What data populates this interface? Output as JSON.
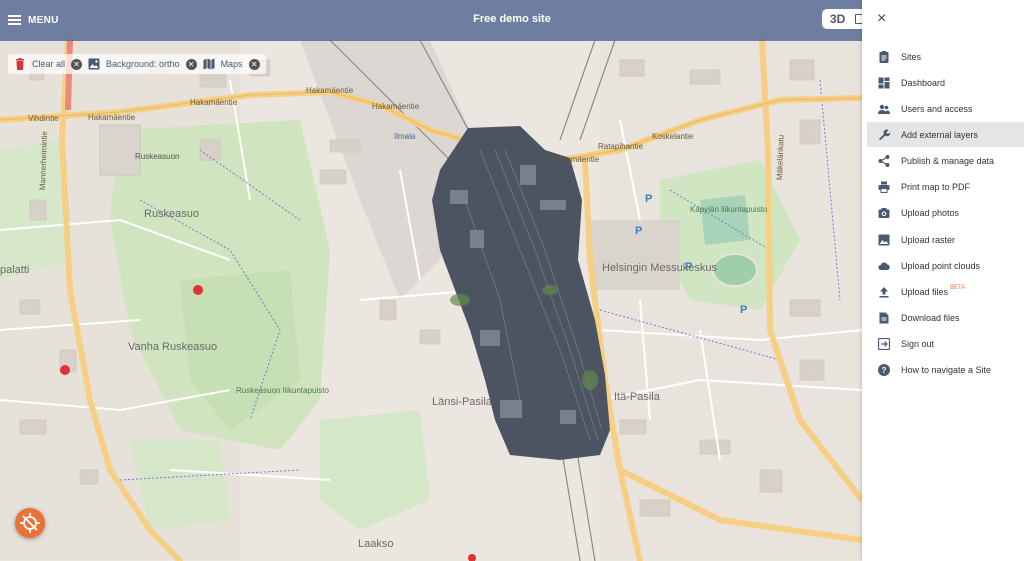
{
  "topbar": {
    "menu_label": "MENU",
    "site_title": "Free demo site",
    "view_toggle_label": "3D"
  },
  "layer_chips": [
    {
      "label": "Clear all",
      "icon": "trash-icon"
    },
    {
      "label": "Background: ortho",
      "icon": "image-icon"
    },
    {
      "label": "Maps",
      "icon": "map-icon"
    }
  ],
  "map": {
    "labels": {
      "hakamaentie_1": "Hakamäentie",
      "hakamaentie_2": "Hakamäentie",
      "hakamaentie_3": "Hakamäentie",
      "hakamaentie_4": "Hakamäentie",
      "hakamaentie_5": "Hakamäentie",
      "vihdintie": "Vihdintie",
      "mannerheimintie": "Mannerheimintie",
      "ruskeasuo_small": "Ruskeasuon",
      "ruskeasuo": "Ruskeasuo",
      "vanha_ruskeasuo": "Vanha Ruskeasuo",
      "ruskeasuon_puisto": "Ruskeasuon liikuntapuisto",
      "ilmala": "Ilmala",
      "helsinki_messukeskus": "Helsingin Messukeskus",
      "kapylan_puisto": "Käpylän liikuntapuisto",
      "jansi_pasila": "Länsi-Pasila",
      "ita_pasila": "Itä-Pasila",
      "laakso": "Laakso",
      "palatti": "palatti",
      "makelankatu": "Mäkelänkatu",
      "ratapihantie": "Ratapihantie",
      "koskelantie": "Koskelantie"
    }
  },
  "panel": {
    "close_label": "×",
    "items": [
      {
        "label": "Sites",
        "icon": "clipboard-icon",
        "active": false
      },
      {
        "label": "Dashboard",
        "icon": "dashboard-icon",
        "active": false
      },
      {
        "label": "Users and access",
        "icon": "users-icon",
        "active": false
      },
      {
        "label": "Add external layers",
        "icon": "wrench-icon",
        "active": true
      },
      {
        "label": "Publish & manage data",
        "icon": "share-icon",
        "active": false
      },
      {
        "label": "Print map to PDF",
        "icon": "printer-icon",
        "active": false
      },
      {
        "label": "Upload photos",
        "icon": "camera-icon",
        "active": false
      },
      {
        "label": "Upload raster",
        "icon": "image-icon",
        "active": false
      },
      {
        "label": "Upload point clouds",
        "icon": "cloud-icon",
        "active": false
      },
      {
        "label": "Upload files",
        "icon": "upload-icon",
        "active": false,
        "badge": "BETA"
      },
      {
        "label": "Download files",
        "icon": "file-icon",
        "active": false
      },
      {
        "label": "Sign out",
        "icon": "sign-out-icon",
        "active": false
      },
      {
        "label": "How to navigate a Site",
        "icon": "help-icon",
        "active": false
      }
    ]
  },
  "colors": {
    "topbar": "#586c96",
    "accent": "#e8733a",
    "park": "#cfe6c0",
    "road_major": "#f6cf84",
    "active_item_bg": "#e5e5e8"
  }
}
